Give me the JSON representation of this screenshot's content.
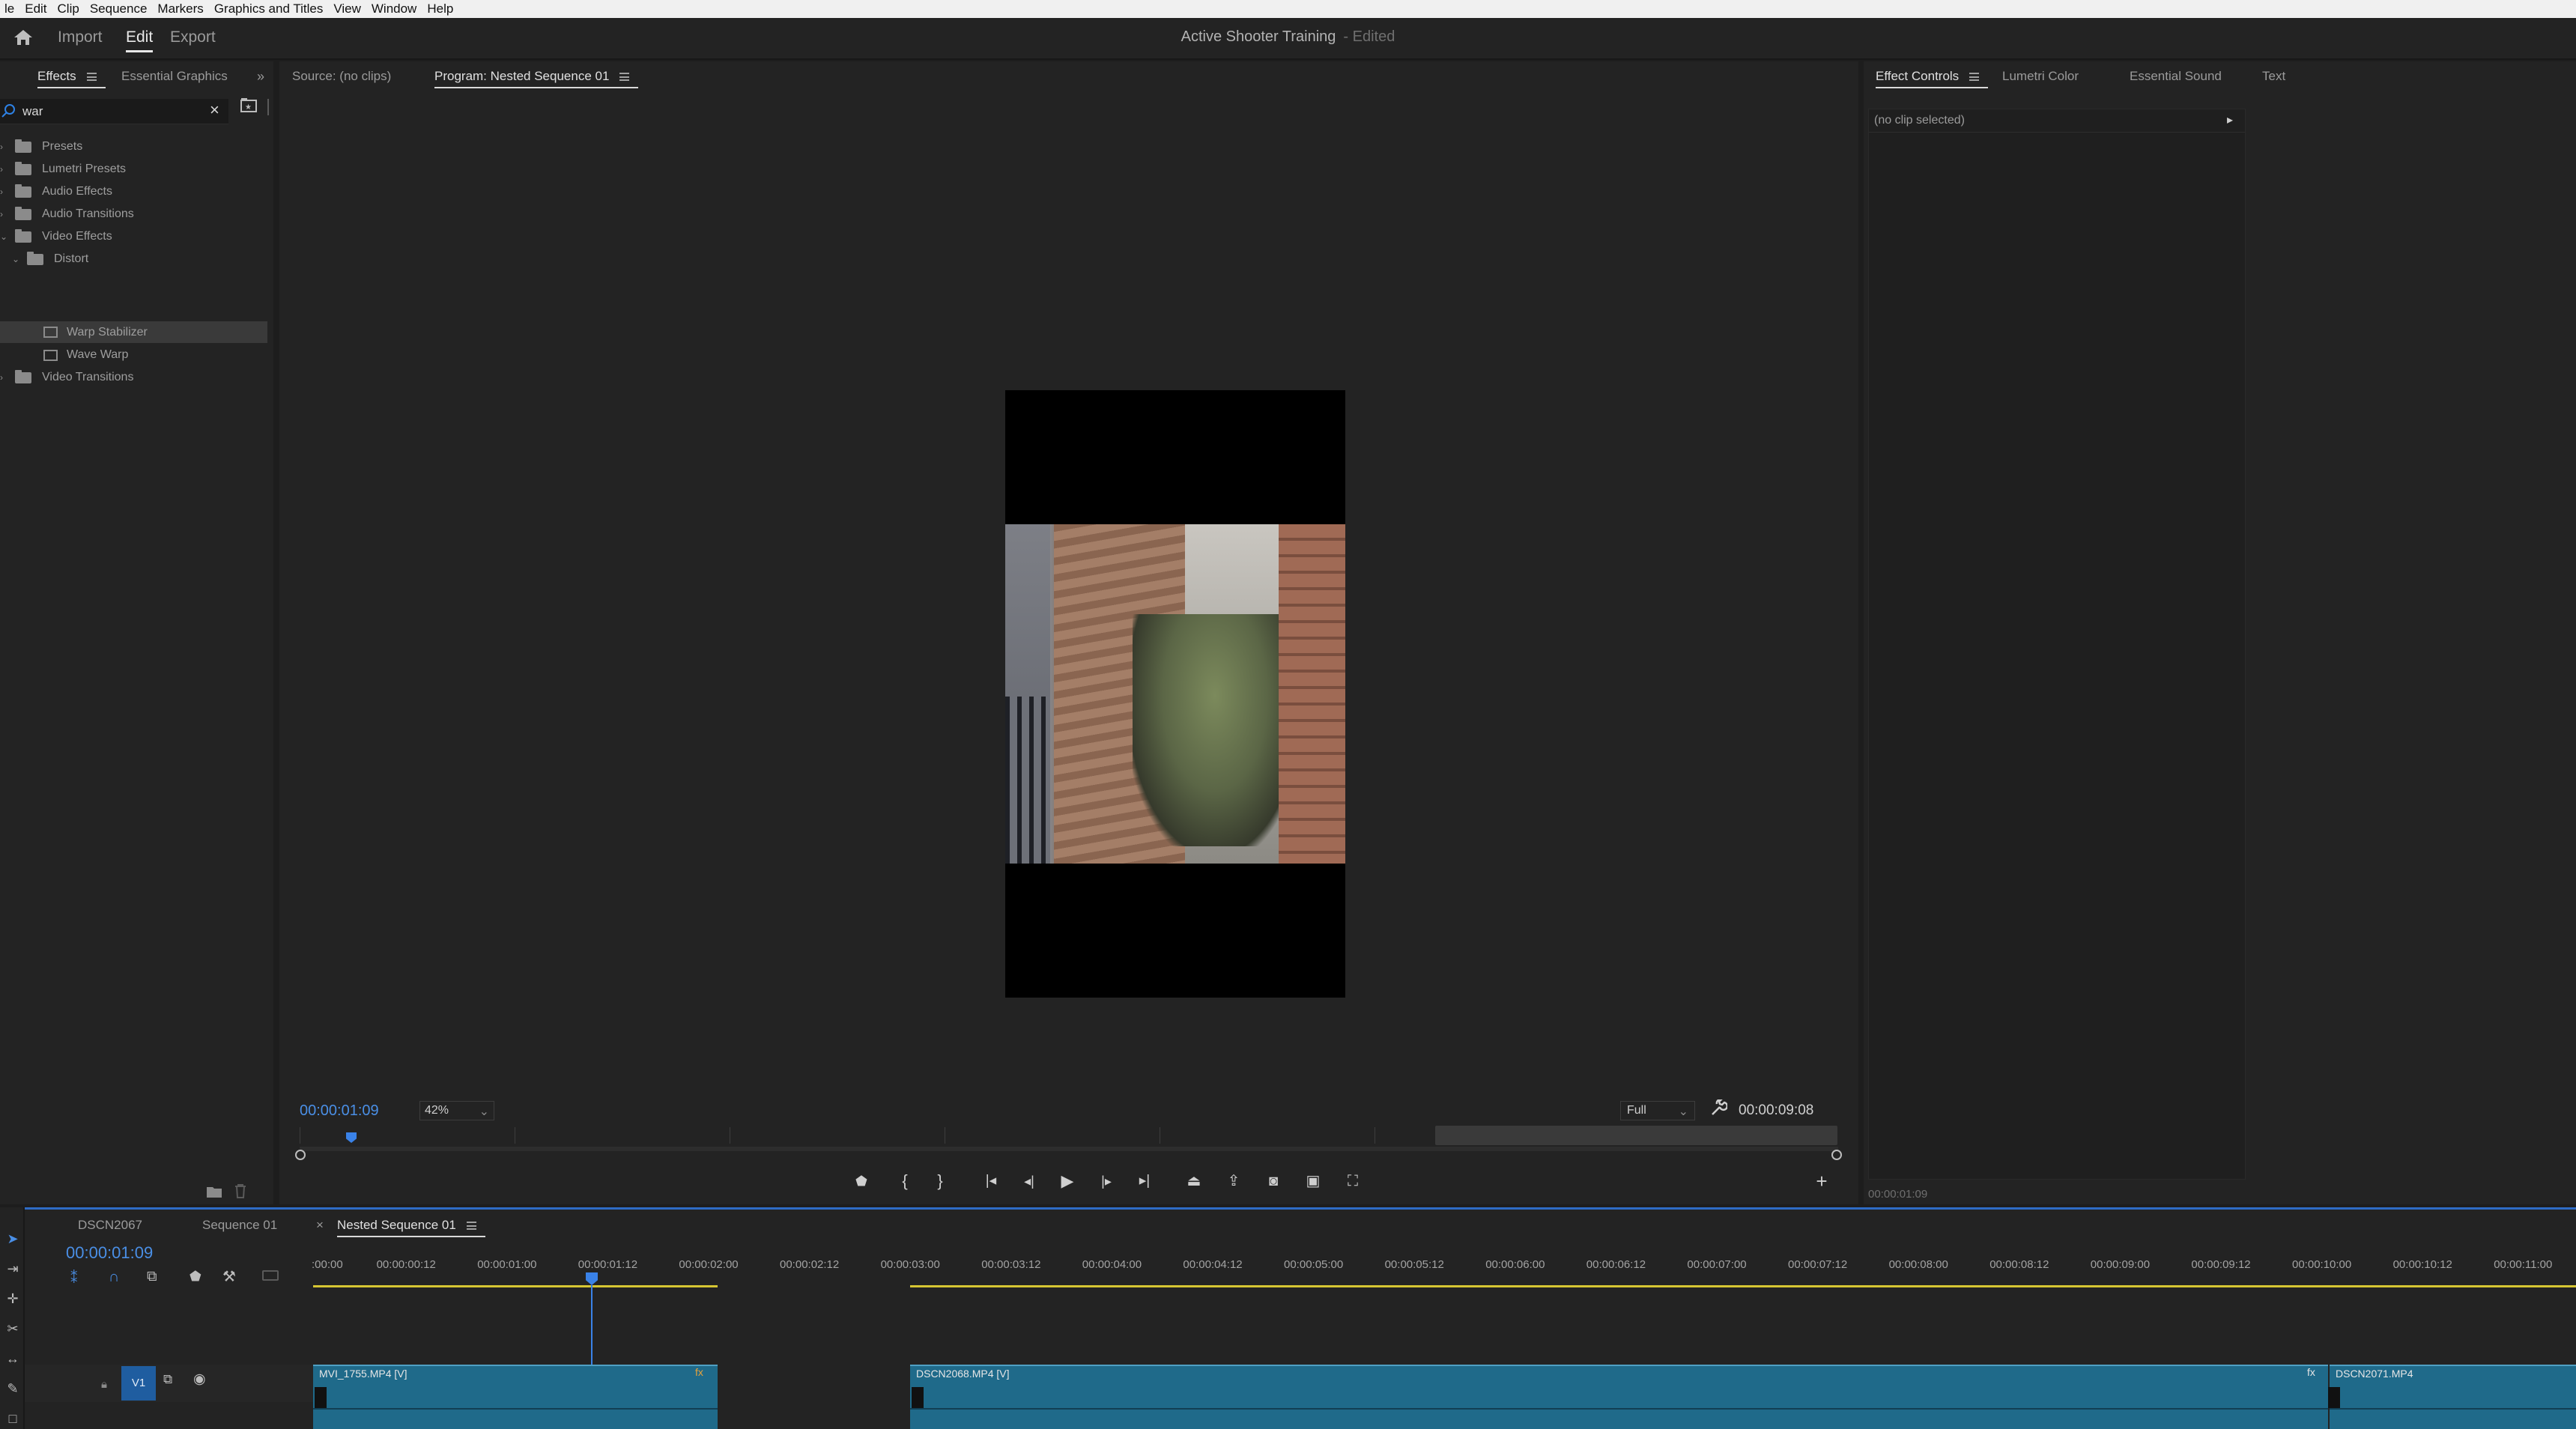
{
  "menubar": [
    "le",
    "Edit",
    "Clip",
    "Sequence",
    "Markers",
    "Graphics and Titles",
    "View",
    "Window",
    "Help"
  ],
  "header": {
    "workspaces": [
      "Import",
      "Edit",
      "Export"
    ],
    "active_workspace": "Edit",
    "project_title": "Active Shooter Training",
    "status": "- Edited"
  },
  "effects_panel": {
    "tabs": [
      "Effects",
      "Essential Graphics"
    ],
    "search": {
      "value": "war"
    },
    "tree": [
      {
        "label": "Presets",
        "kind": "folder",
        "level": 0
      },
      {
        "label": "Lumetri Presets",
        "kind": "folder",
        "level": 0
      },
      {
        "label": "Audio Effects",
        "kind": "folder",
        "level": 0
      },
      {
        "label": "Audio Transitions",
        "kind": "folder",
        "level": 0
      },
      {
        "label": "Video Effects",
        "kind": "folder",
        "level": 0,
        "expanded": true
      },
      {
        "label": "Distort",
        "kind": "folder",
        "level": 1,
        "expanded": true
      },
      {
        "label": "Warp Stabilizer",
        "kind": "effect",
        "level": 2,
        "selected": true
      },
      {
        "label": "Wave Warp",
        "kind": "effect",
        "level": 2
      },
      {
        "label": "Video Transitions",
        "kind": "folder",
        "level": 0
      }
    ]
  },
  "program_monitor": {
    "tabs": [
      "Source: (no clips)",
      "Program: Nested Sequence 01"
    ],
    "current_time": "00:00:01:09",
    "zoom": "42%",
    "resolution": "Full",
    "duration": "00:00:09:08"
  },
  "effect_controls": {
    "tabs": [
      "Effect Controls",
      "Lumetri Color",
      "Essential Sound",
      "Text"
    ],
    "message": "(no clip selected)",
    "time": "00:00:01:09"
  },
  "timeline": {
    "tabs": [
      "DSCN2067",
      "Sequence 01",
      "Nested Sequence 01"
    ],
    "timecode": "00:00:01:09",
    "ruler": [
      ":00:00",
      "00:00:00:12",
      "00:00:01:00",
      "00:00:01:12",
      "00:00:02:00",
      "00:00:02:12",
      "00:00:03:00",
      "00:00:03:12",
      "00:00:04:00",
      "00:00:04:12",
      "00:00:05:00",
      "00:00:05:12",
      "00:00:06:00",
      "00:00:06:12",
      "00:00:07:00",
      "00:00:07:12",
      "00:00:08:00",
      "00:00:08:12",
      "00:00:09:00",
      "00:00:09:12",
      "00:00:10:00",
      "00:00:10:12",
      "00:00:11:00"
    ],
    "track": "V1",
    "clips": [
      "MVI_1755.MP4 [V]",
      "DSCN2068.MP4 [V]",
      "DSCN2071.MP4"
    ]
  },
  "colors": {
    "accent": "#2e6bc5",
    "timecode": "#4a8fe6",
    "clip": "#1f6a8a",
    "in_out": "#d6c633"
  }
}
